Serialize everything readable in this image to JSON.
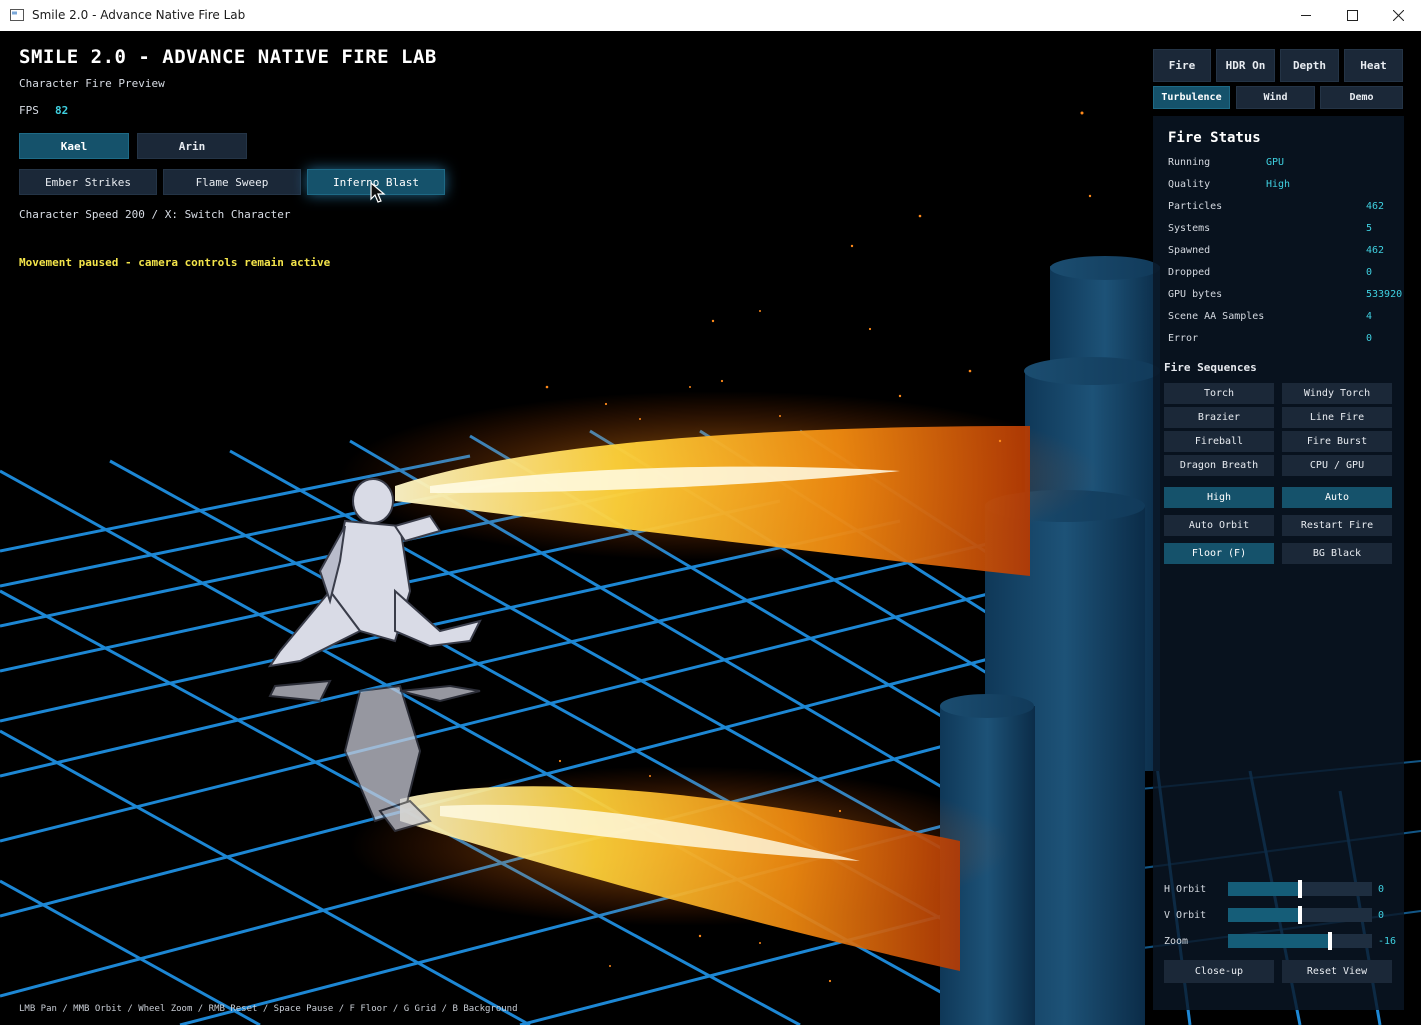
{
  "window": {
    "title": "Smile 2.0 - Advance Native Fire Lab"
  },
  "hud": {
    "title": "SMILE 2.0 - ADVANCE NATIVE FIRE LAB",
    "subtitle": "Character Fire Preview",
    "fps_label": "FPS",
    "fps_value": "82",
    "characters": [
      "Kael",
      "Arin"
    ],
    "active_character": "Kael",
    "attacks": [
      "Ember Strikes",
      "Flame Sweep",
      "Inferno Blast"
    ],
    "active_attack": "Inferno Blast",
    "speed_text": "Character Speed 200  /  X: Switch Character",
    "notice": "Movement paused - camera controls remain active",
    "hint": "LMB Pan / MMB Orbit / Wheel Zoom / RMB Reset / Space Pause / F Floor / G Grid / B Background"
  },
  "toolbar": {
    "row1": [
      "Fire",
      "HDR On",
      "Depth",
      "Heat"
    ],
    "row2": [
      "Turbulence",
      "Wind",
      "Demo"
    ],
    "active_row2": "Turbulence"
  },
  "status": {
    "title": "Fire Status",
    "running_label": "Running",
    "running_value": "GPU",
    "quality_label": "Quality",
    "quality_value": "High",
    "stats": [
      {
        "label": "Particles",
        "value": "462"
      },
      {
        "label": "Systems",
        "value": "5"
      },
      {
        "label": "Spawned",
        "value": "462"
      },
      {
        "label": "Dropped",
        "value": "0"
      },
      {
        "label": "GPU bytes",
        "value": "533920"
      },
      {
        "label": "Scene AA Samples",
        "value": "4"
      },
      {
        "label": "Error",
        "value": "0"
      }
    ]
  },
  "sequences": {
    "title": "Fire Sequences",
    "items": [
      "Torch",
      "Windy Torch",
      "Brazier",
      "Line Fire",
      "Fireball",
      "Fire Burst",
      "Dragon Breath",
      "CPU / GPU"
    ],
    "quality_button": "High",
    "mode_button": "Auto",
    "auto_orbit": "Auto Orbit",
    "restart": "Restart Fire",
    "floor": "Floor (F)",
    "background": "BG Black"
  },
  "camera": {
    "h_orbit_label": "H Orbit",
    "h_orbit_value": "0",
    "h_orbit_level": 0.5,
    "v_orbit_label": "V Orbit",
    "v_orbit_value": "0",
    "v_orbit_level": 0.5,
    "zoom_label": "Zoom",
    "zoom_value": "-16",
    "zoom_level": 0.71,
    "closeup": "Close-up",
    "reset": "Reset View"
  },
  "icons": [
    "app-icon",
    "minimize-icon",
    "maximize-icon",
    "close-icon",
    "cursor-icon"
  ],
  "colors": {
    "accent": "#3fd0e0",
    "active_button": "#15526b",
    "button": "#1b2838",
    "notice": "#f3e44a",
    "grid": "#1f8fe0"
  }
}
